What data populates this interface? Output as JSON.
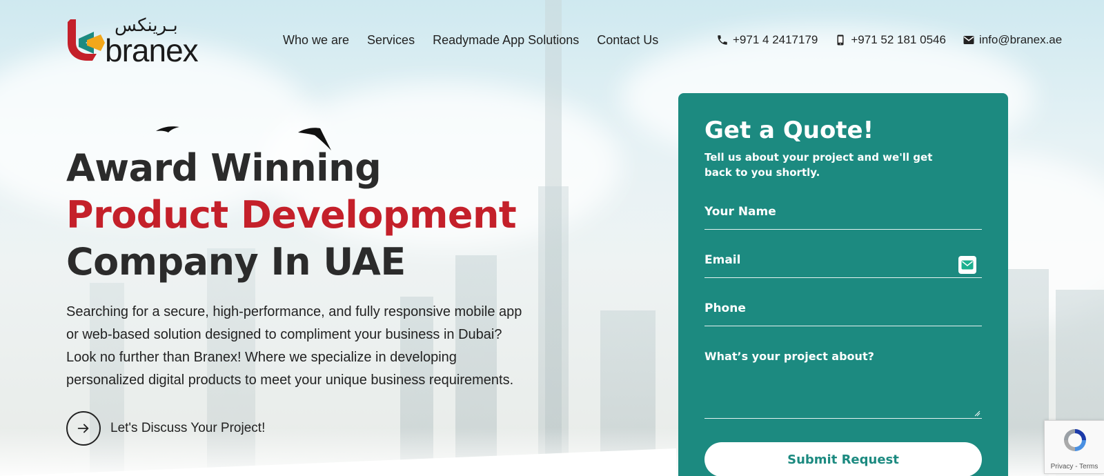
{
  "header": {
    "logo": {
      "arabic": "بـرينكس",
      "text": "branex"
    },
    "nav": [
      "Who we are",
      "Services",
      "Readymade App Solutions",
      "Contact Us"
    ],
    "contacts": {
      "phone": "+971 4 2417179",
      "mobile": "+971 52 181 0546",
      "email": "info@branex.ae"
    }
  },
  "hero": {
    "title_line1": "Award Winning",
    "title_line2": "Product Development",
    "title_line3": "Company In UAE",
    "description": "Searching for a secure, high-performance, and fully responsive mobile app or web-based solution designed to compliment your business in Dubai? Look no further than Branex! Where we specialize in developing personalized digital products to meet your unique business requirements.",
    "cta_label": "Let's Discuss Your Project!"
  },
  "quote_form": {
    "title": "Get a Quote!",
    "subtitle": "Tell us about your project and we'll get back to you shortly.",
    "name_placeholder": "Your Name",
    "email_placeholder": "Email",
    "phone_placeholder": "Phone",
    "project_placeholder": "What’s your project about?",
    "submit_label": "Submit Request"
  },
  "recaptcha": {
    "terms": "Privacy - Terms"
  },
  "colors": {
    "accent_red": "#c4202a",
    "form_teal": "#1c8a80",
    "heading_dark": "#2b2b2b"
  },
  "icons": [
    "phone-icon",
    "mobile-icon",
    "email-icon",
    "arrow-right-icon",
    "recaptcha-icon"
  ]
}
